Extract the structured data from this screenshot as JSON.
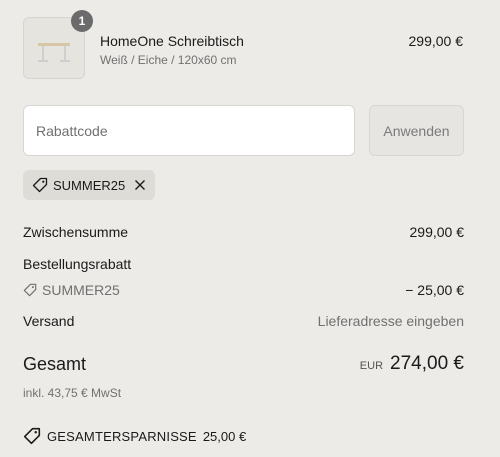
{
  "product": {
    "quantity": "1",
    "name": "HomeOne Schreibtisch",
    "variant": "Weiß / Eiche / 120x60 cm",
    "price": "299,00 €"
  },
  "discount": {
    "placeholder": "Rabattcode",
    "apply_label": "Anwenden",
    "applied_code": "SUMMER25"
  },
  "summary": {
    "subtotal_label": "Zwischensumme",
    "subtotal_value": "299,00 €",
    "order_discount_label": "Bestellungsrabatt",
    "order_discount_code": "SUMMER25",
    "order_discount_value": "− 25,00 €",
    "shipping_label": "Versand",
    "shipping_value": "Lieferadresse eingeben"
  },
  "total": {
    "label": "Gesamt",
    "currency": "EUR",
    "value": "274,00 €",
    "tax_note": "inkl. 43,75 € MwSt"
  },
  "savings": {
    "label": "GESAMTERSPARNISSE",
    "value": "25,00 €"
  },
  "icons": {
    "tag": "tag-icon",
    "close": "close-icon"
  },
  "colors": {
    "background": "#ecebe7",
    "badge": "#6b6b6b"
  }
}
